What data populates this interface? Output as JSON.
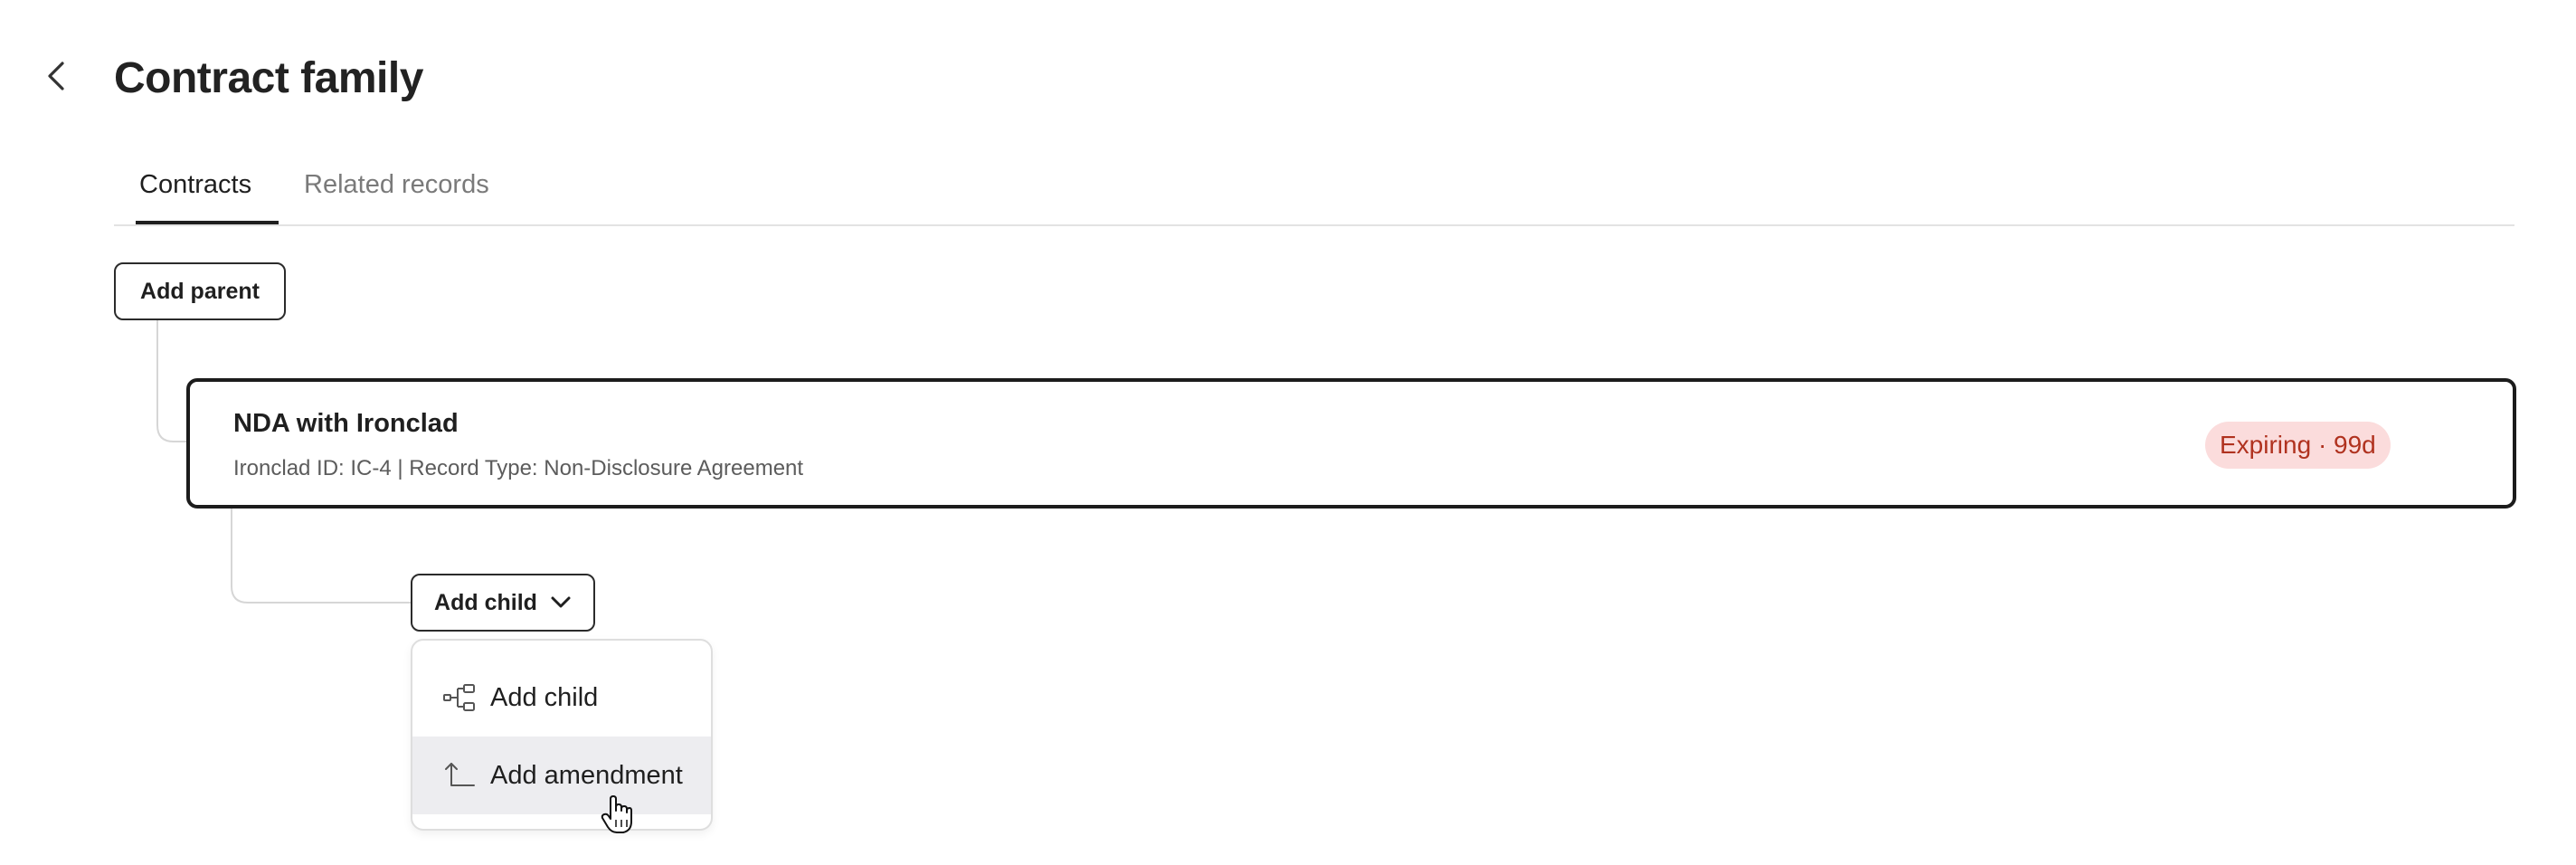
{
  "header": {
    "title": "Contract family",
    "back_icon": "chevron-left-icon"
  },
  "tabs": [
    {
      "label": "Contracts",
      "active": true
    },
    {
      "label": "Related records",
      "active": false
    }
  ],
  "tree": {
    "add_parent_label": "Add parent",
    "contract": {
      "title": "NDA with Ironclad",
      "meta": "Ironclad ID: IC-4 | Record Type: Non-Disclosure Agreement",
      "status": "Expiring · 99d",
      "status_color": "#b0321f",
      "status_bg": "#fbdcdc"
    },
    "add_child_label": "Add child"
  },
  "dropdown": {
    "items": [
      {
        "label": "Add child",
        "icon": "hierarchy-icon",
        "highlighted": false
      },
      {
        "label": "Add amendment",
        "icon": "amendment-arrow-icon",
        "highlighted": true
      }
    ]
  }
}
